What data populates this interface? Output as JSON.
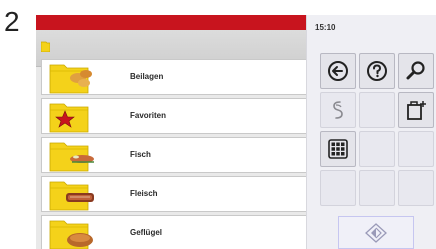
{
  "step_number": "2",
  "clock": "15:10",
  "list": {
    "items": [
      {
        "label": "Beilagen",
        "icon": "folder-potatoes-icon"
      },
      {
        "label": "Favoriten",
        "icon": "folder-star-icon"
      },
      {
        "label": "Fisch",
        "icon": "folder-fish-icon"
      },
      {
        "label": "Fleisch",
        "icon": "folder-meat-icon"
      },
      {
        "label": "Geflügel",
        "icon": "folder-poultry-icon"
      }
    ]
  },
  "controls": {
    "back": "back-arrow-icon",
    "help": "help-icon",
    "search": "search-icon",
    "script": "script-icon",
    "new_folder": "new-folder-icon",
    "grid": "grid-icon",
    "start": "start-icon"
  },
  "colors": {
    "accent_red": "#c8141e",
    "folder_yellow": "#f4d21a",
    "panel_bg": "#efeff4"
  }
}
